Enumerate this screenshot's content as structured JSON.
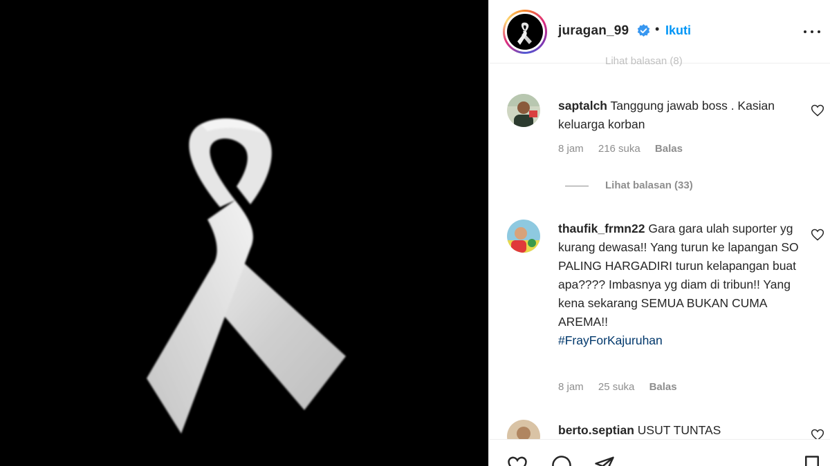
{
  "post": {
    "image_desc_icon": "white-ribbon",
    "background": "#000000"
  },
  "header": {
    "username": "juragan_99",
    "separator": "•",
    "follow_label": "Ikuti",
    "verified_icon": "verified-badge-icon",
    "more_icon": "more-options-icon"
  },
  "faded_top": "Lihat balasan (8)",
  "comments": [
    {
      "username": "saptalch",
      "text": "Tanggung jawab boss . Kasian keluarga korban",
      "time": "8 jam",
      "likes": "216 suka",
      "reply_label": "Balas"
    },
    {
      "username": "thaufik_frmn22",
      "text": "Gara gara ulah suporter yg kurang dewasa!! Yang turun ke lapangan SO PALING HARGADIRI turun kelapangan buat apa???? Imbasnya yg diam di tribun!! Yang kena sekarang SEMUA BUKAN CUMA AREMA!!",
      "hashtag": "#FrayForKajuruhan",
      "time": "8 jam",
      "likes": "25 suka",
      "reply_label": "Balas"
    },
    {
      "username": "berto.septian",
      "text": "USUT TUNTAS"
    }
  ],
  "view_replies": "Lihat balasan (33)",
  "actions": [
    "like-icon",
    "comment-icon",
    "share-icon",
    "save-icon"
  ],
  "colors": {
    "link_blue": "#0095f6",
    "muted": "#8e8e8e",
    "text": "#262626",
    "hashtag": "#00376b"
  }
}
